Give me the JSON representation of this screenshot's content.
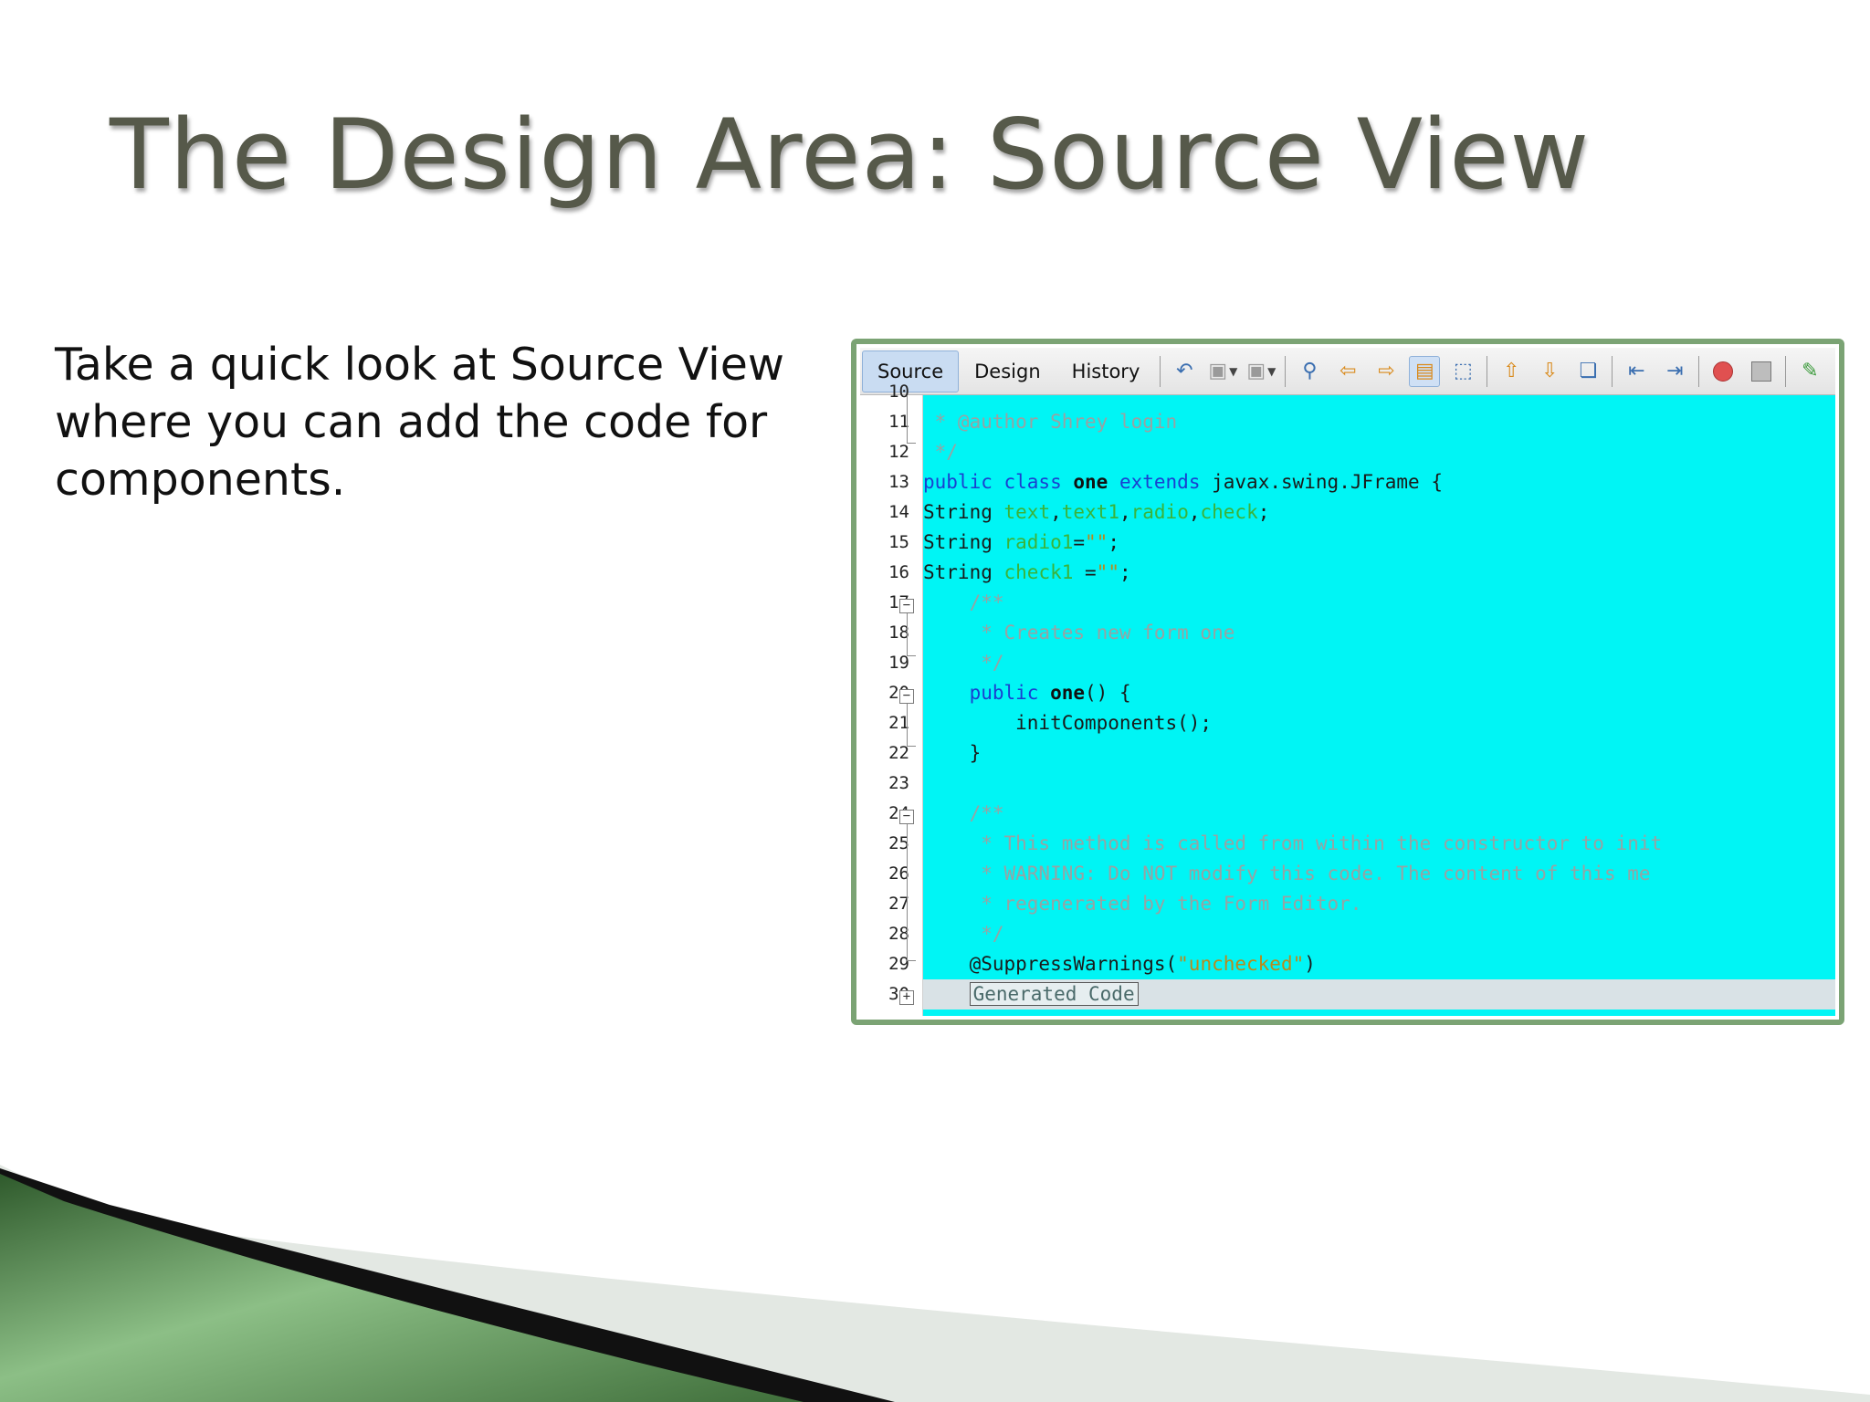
{
  "slide": {
    "title": "The Design Area: Source View",
    "body": "Take a quick look at Source View where you can add the code for components."
  },
  "ide": {
    "tabs": [
      "Source",
      "Design",
      "History"
    ],
    "active_tab": "Source",
    "toolbar_icons": [
      "last-edit-icon",
      "back-icon",
      "forward-icon",
      "find-icon",
      "find-previous-icon",
      "find-next-icon",
      "toggle-highlight-icon",
      "toggle-rectangular-selection-icon",
      "previous-bookmark-icon",
      "next-bookmark-icon",
      "toggle-bookmark-icon",
      "shift-left-icon",
      "shift-right-icon",
      "start-macro-icon",
      "stop-macro-icon",
      "comment-icon"
    ],
    "code_lines": [
      {
        "n": "11",
        "t": " * @author Shrey login"
      },
      {
        "n": "12",
        "t": " */"
      },
      {
        "n": "13",
        "t": "public class one extends javax.swing.JFrame {"
      },
      {
        "n": "14",
        "t": "String text,text1,radio,check;"
      },
      {
        "n": "15",
        "t": "String radio1=\"\";"
      },
      {
        "n": "16",
        "t": "String check1 =\"\";"
      },
      {
        "n": "17",
        "t": "    /**"
      },
      {
        "n": "18",
        "t": "     * Creates new form one"
      },
      {
        "n": "19",
        "t": "     */"
      },
      {
        "n": "20",
        "t": "    public one() {"
      },
      {
        "n": "21",
        "t": "        initComponents();"
      },
      {
        "n": "22",
        "t": "    }"
      },
      {
        "n": "23",
        "t": ""
      },
      {
        "n": "24",
        "t": "    /**"
      },
      {
        "n": "25",
        "t": "     * This method is called from within the constructor to init"
      },
      {
        "n": "26",
        "t": "     * WARNING: Do NOT modify this code. The content of this me"
      },
      {
        "n": "27",
        "t": "     * regenerated by the Form Editor."
      },
      {
        "n": "28",
        "t": "     */"
      },
      {
        "n": "29",
        "t": "    @SuppressWarnings(\"unchecked\")"
      },
      {
        "n": "30",
        "t": "    Generated Code"
      }
    ]
  },
  "colors": {
    "editor_background": "#00f5f5",
    "frame_border": "#7ba374",
    "accent_green": "#3f6e3a",
    "title_color": "#56594a"
  }
}
